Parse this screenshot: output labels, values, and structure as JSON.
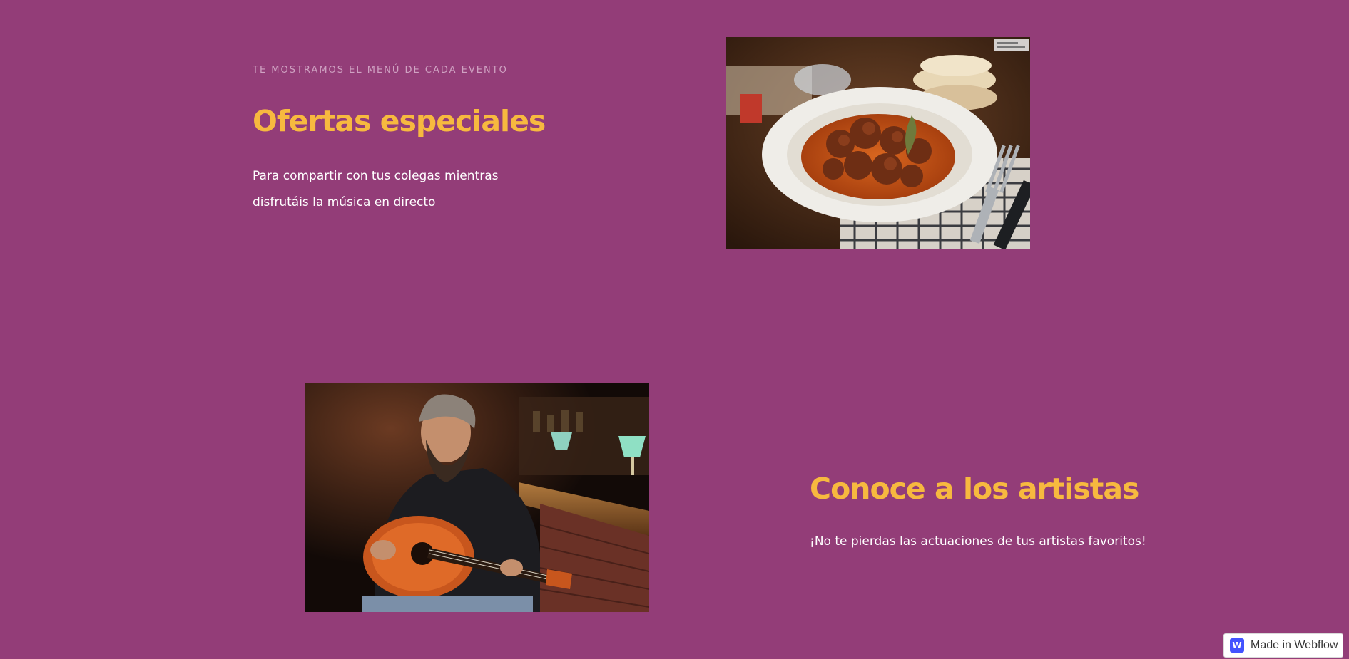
{
  "offers": {
    "eyebrow": "TE MOSTRAMOS EL MENÚ DE CADA EVENTO",
    "title": "Ofertas especiales",
    "description": "Para compartir con tus colegas mientras disfrutáis la música en directo"
  },
  "artists": {
    "title": "Conoce a los artistas",
    "description": "¡No te pierdas las actuaciones de tus artistas favoritos!"
  },
  "badge": {
    "label": "Made in Webflow",
    "logo": "W"
  },
  "colors": {
    "background": "#933d78",
    "accent": "#f7b93f",
    "eyebrow": "#cfa2c2",
    "body": "#ffffff",
    "webflow_brand": "#4353ff"
  },
  "icons": {
    "badge_icon": "webflow-logo-icon"
  }
}
